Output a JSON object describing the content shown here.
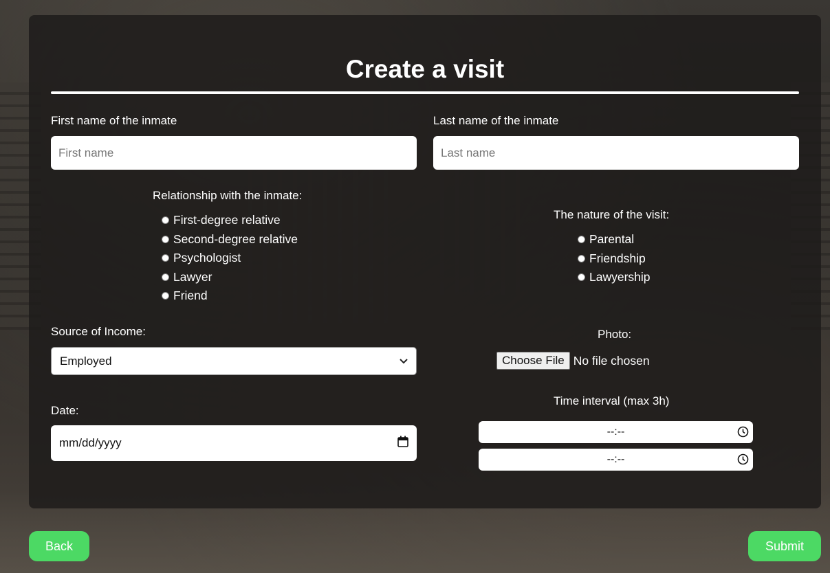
{
  "form": {
    "title": "Create a visit",
    "first_name": {
      "label": "First name of the inmate",
      "placeholder": "First name",
      "value": ""
    },
    "last_name": {
      "label": "Last name of the inmate",
      "placeholder": "Last name",
      "value": ""
    },
    "relationship": {
      "label": "Relationship with the inmate:",
      "options": [
        "First-degree relative",
        "Second-degree relative",
        "Psychologist",
        "Lawyer",
        "Friend"
      ]
    },
    "nature": {
      "label": "The nature of the visit:",
      "options": [
        "Parental",
        "Friendship",
        "Lawyership"
      ]
    },
    "income": {
      "label": "Source of Income:",
      "selected": "Employed"
    },
    "photo": {
      "label": "Photo:",
      "button": "Choose File",
      "status": "No file chosen"
    },
    "date": {
      "label": "Date:",
      "placeholder": "mm/dd/yyyy"
    },
    "time": {
      "label": "Time interval (max 3h)",
      "start_placeholder": "--:--",
      "end_placeholder": "--:--"
    }
  },
  "buttons": {
    "back": "Back",
    "submit": "Submit"
  },
  "colors": {
    "accent": "#4cd964",
    "panel": "#1e1c1b",
    "text": "#ffffff"
  },
  "icons": {
    "calendar": "calendar-icon",
    "clock": "clock-icon",
    "select": "chevron-down-icon"
  }
}
